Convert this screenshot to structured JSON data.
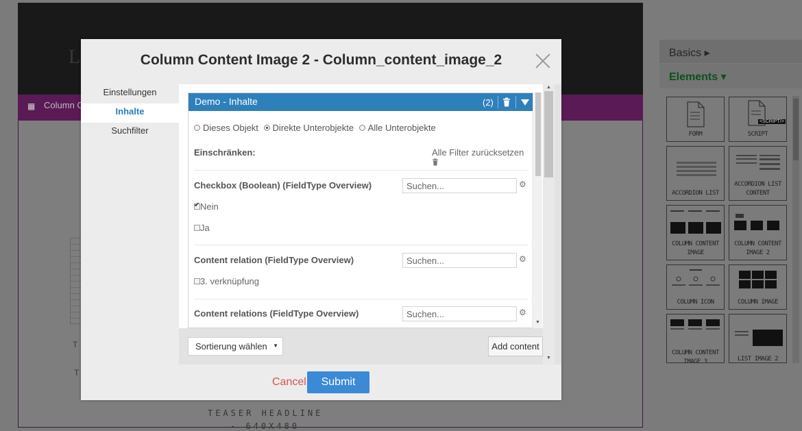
{
  "background": {
    "header_letter": "L",
    "bar_label": "Column C",
    "teaser_t1": "T",
    "teaser_t2": "T",
    "teaser_headline": "TEASER HEADLINE",
    "teaser_sub": "- 640X480"
  },
  "sidebar": {
    "basics": "Basics ▸",
    "elements": "Elements ▾",
    "tiles": [
      {
        "label": "FORM"
      },
      {
        "label": "SCRIPT",
        "badge": "<SCRIPT/>"
      },
      {
        "label": "ACCORDION LIST"
      },
      {
        "label": "ACCORDION LIST CONTENT"
      },
      {
        "label": "COLUMN CONTENT IMAGE"
      },
      {
        "label": "COLUMN CONTENT IMAGE 2"
      },
      {
        "label": "COLUMN ICON"
      },
      {
        "label": "COLUMN IMAGE"
      },
      {
        "label": "COLUMN CONTENT IMAGE 3"
      },
      {
        "label": "LIST IMAGE 2"
      }
    ]
  },
  "modal": {
    "title": "Column Content Image 2 - Column_content_image_2",
    "tabs": [
      "Einstellungen",
      "Inhalte",
      "Suchfilter"
    ],
    "active_tab": "Inhalte",
    "panel": {
      "title": "Demo - Inhalte",
      "count": "(2)",
      "radio_options": [
        {
          "label": "Dieses Objekt",
          "checked": false
        },
        {
          "label": "Direkte Unterobjekte",
          "checked": true
        },
        {
          "label": "Alle Unterobjekte",
          "checked": false
        }
      ],
      "restrict_label": "Einschränken:",
      "reset_label": "Alle Filter zurücksetzen",
      "filters": [
        {
          "title": "Checkbox (Boolean) (FieldType Overview)",
          "placeholder": "Suchen...",
          "options": [
            {
              "label": "Nein",
              "checked": true
            },
            {
              "label": "Ja",
              "checked": false
            }
          ]
        },
        {
          "title": "Content relation (FieldType Overview)",
          "placeholder": "Suchen...",
          "options": [
            {
              "label": "3. verknüpfung",
              "checked": false
            }
          ]
        },
        {
          "title": "Content relations (FieldType Overview)",
          "placeholder": "Suchen...",
          "options": []
        }
      ]
    },
    "sort_label": "Sortierung wählen",
    "add_content_label": "Add content",
    "cancel_label": "Cancel",
    "submit_label": "Submit"
  },
  "colors": {
    "accent_blue": "#2e80bb",
    "submit_blue": "#3b8ad6",
    "cancel_red": "#d9534f",
    "tab_active": "#2a7bbf"
  }
}
